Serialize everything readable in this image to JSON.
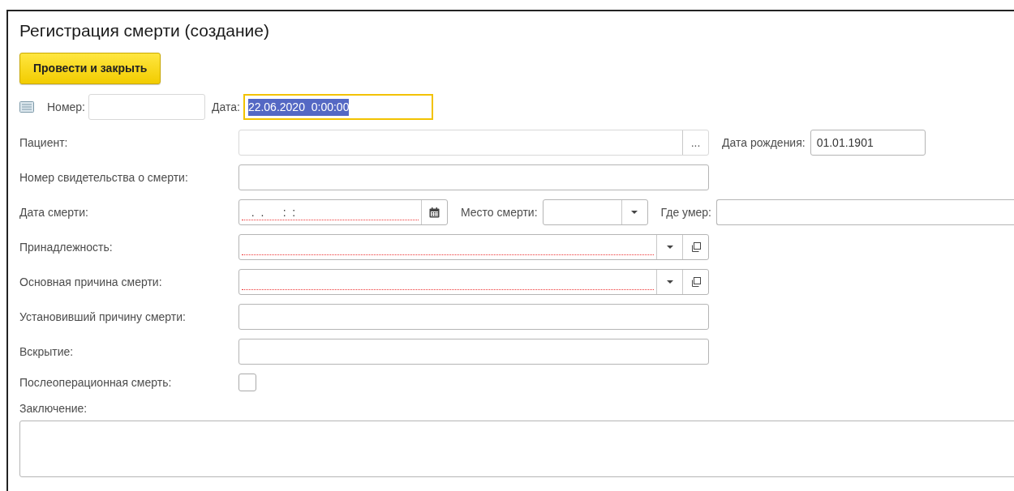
{
  "title": "Регистрация смерти (создание)",
  "buttons": [
    {
      "label": "Провести и закрыть",
      "default": true
    }
  ],
  "header": {
    "number": {
      "label": "Номер:"
    },
    "date": {
      "label": "Дата:",
      "value": "22.06.2020  0:00:00",
      "focused": true
    }
  },
  "rows": [
    {
      "label": "Пациент:",
      "kind": "choice",
      "required": false,
      "button_text": "...",
      "extras": [
        {
          "label": "Дата рождения:",
          "kind": "text",
          "value": "01.01.1901"
        }
      ]
    },
    {
      "label": "Номер свидетельства о смерти:",
      "kind": "text",
      "required": false
    },
    {
      "label": "Дата смерти:",
      "kind": "date",
      "required": true,
      "value": "  .  .      :  :",
      "extras": [
        {
          "label": "Место смерти:",
          "kind": "dropdown"
        },
        {
          "label": "Где умер:",
          "kind": "wide"
        }
      ]
    },
    {
      "label": "Принадлежность:",
      "kind": "combo",
      "required": true
    },
    {
      "label": "Основная причина смерти:",
      "kind": "combo",
      "required": true
    },
    {
      "label": "Установивший причину смерти:",
      "kind": "text",
      "required": false
    },
    {
      "label": "Вскрытие:",
      "kind": "text",
      "required": false
    },
    {
      "label": "Послеоперационная смерть:",
      "kind": "checkbox",
      "checked": false
    }
  ],
  "conclusion": {
    "label": "Заключение:"
  }
}
